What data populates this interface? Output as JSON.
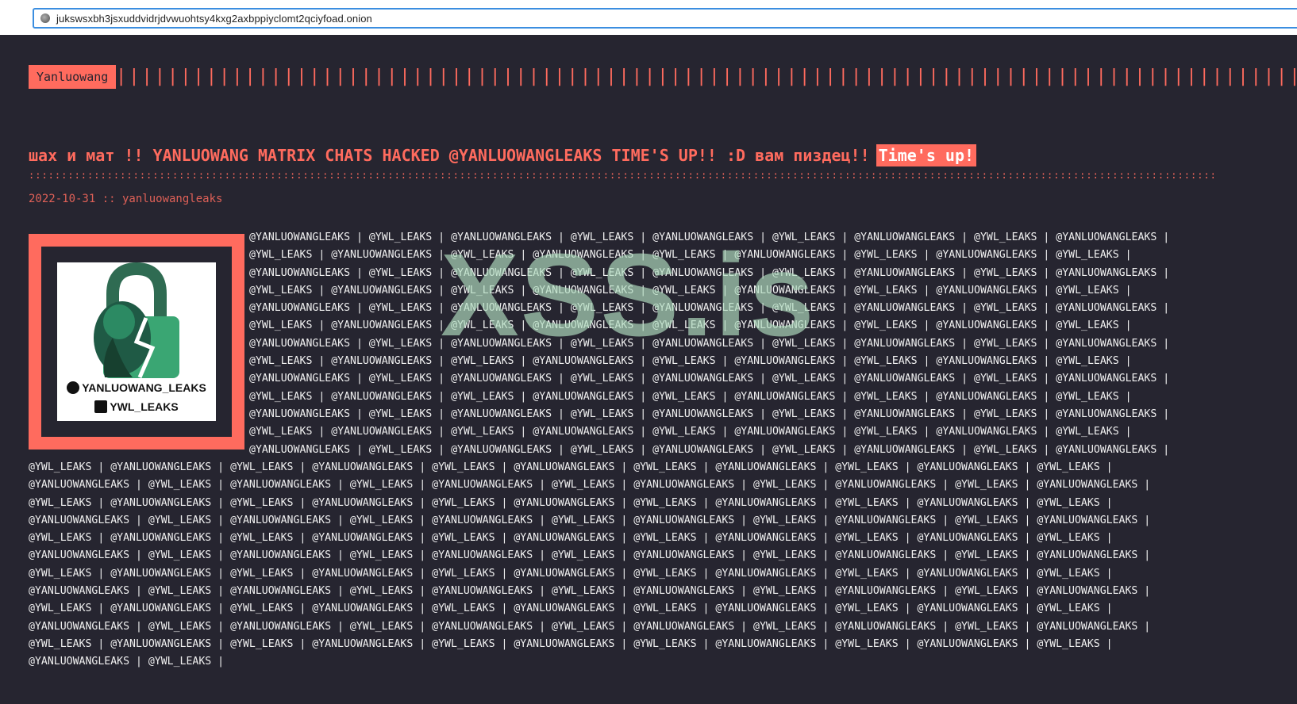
{
  "browser": {
    "url": "jukswsxbh3jsxuddvidrjdvwuohtsy4kxg2axbppiyclomt2qciyfoad.onion"
  },
  "site": {
    "logo": "Yanluowang"
  },
  "post": {
    "title": "шах и мат !! YANLUOWANG MATRIX CHATS HACKED @YANLUOWANGLEAKS TIME'S UP!! :D вам пиздец!!",
    "title_highlight": "Time's up!",
    "meta": "2022-10-31 :: yanluowangleaks"
  },
  "avatar": {
    "handle_twitter": "YANLUOWANG_LEAKS",
    "handle_telegram": "YWL_LEAKS",
    "twitter_icon": "twitter-icon",
    "telegram_icon": "telegram-icon"
  },
  "leak": {
    "top": "@YANLUOWANGLEAKS | @YWL_LEAKS | @YANLUOWANGLEAKS | @YWL_LEAKS | @YANLUOWANGLEAKS | @YWL_LEAKS | @YANLUOWANGLEAKS | @YWL_LEAKS | @YANLUOWANGLEAKS |\n@YWL_LEAKS | @YANLUOWANGLEAKS | @YWL_LEAKS | @YANLUOWANGLEAKS | @YWL_LEAKS | @YANLUOWANGLEAKS | @YWL_LEAKS | @YANLUOWANGLEAKS | @YWL_LEAKS |\n@YANLUOWANGLEAKS | @YWL_LEAKS | @YANLUOWANGLEAKS | @YWL_LEAKS | @YANLUOWANGLEAKS | @YWL_LEAKS | @YANLUOWANGLEAKS | @YWL_LEAKS | @YANLUOWANGLEAKS |\n@YWL_LEAKS | @YANLUOWANGLEAKS | @YWL_LEAKS | @YANLUOWANGLEAKS | @YWL_LEAKS | @YANLUOWANGLEAKS | @YWL_LEAKS | @YANLUOWANGLEAKS | @YWL_LEAKS |\n@YANLUOWANGLEAKS | @YWL_LEAKS | @YANLUOWANGLEAKS | @YWL_LEAKS | @YANLUOWANGLEAKS | @YWL_LEAKS | @YANLUOWANGLEAKS | @YWL_LEAKS | @YANLUOWANGLEAKS |\n@YWL_LEAKS | @YANLUOWANGLEAKS | @YWL_LEAKS | @YANLUOWANGLEAKS | @YWL_LEAKS | @YANLUOWANGLEAKS | @YWL_LEAKS | @YANLUOWANGLEAKS | @YWL_LEAKS |\n@YANLUOWANGLEAKS | @YWL_LEAKS | @YANLUOWANGLEAKS | @YWL_LEAKS | @YANLUOWANGLEAKS | @YWL_LEAKS | @YANLUOWANGLEAKS | @YWL_LEAKS | @YANLUOWANGLEAKS |\n@YWL_LEAKS | @YANLUOWANGLEAKS | @YWL_LEAKS | @YANLUOWANGLEAKS | @YWL_LEAKS | @YANLUOWANGLEAKS | @YWL_LEAKS | @YANLUOWANGLEAKS | @YWL_LEAKS |\n@YANLUOWANGLEAKS | @YWL_LEAKS | @YANLUOWANGLEAKS | @YWL_LEAKS | @YANLUOWANGLEAKS | @YWL_LEAKS | @YANLUOWANGLEAKS | @YWL_LEAKS | @YANLUOWANGLEAKS |\n@YWL_LEAKS | @YANLUOWANGLEAKS | @YWL_LEAKS | @YANLUOWANGLEAKS | @YWL_LEAKS | @YANLUOWANGLEAKS | @YWL_LEAKS | @YANLUOWANGLEAKS | @YWL_LEAKS |\n@YANLUOWANGLEAKS | @YWL_LEAKS | @YANLUOWANGLEAKS | @YWL_LEAKS | @YANLUOWANGLEAKS | @YWL_LEAKS | @YANLUOWANGLEAKS | @YWL_LEAKS | @YANLUOWANGLEAKS |\n@YWL_LEAKS | @YANLUOWANGLEAKS | @YWL_LEAKS | @YANLUOWANGLEAKS | @YWL_LEAKS | @YANLUOWANGLEAKS | @YWL_LEAKS | @YANLUOWANGLEAKS | @YWL_LEAKS |\n@YANLUOWANGLEAKS | @YWL_LEAKS | @YANLUOWANGLEAKS | @YWL_LEAKS | @YANLUOWANGLEAKS | @YWL_LEAKS | @YANLUOWANGLEAKS | @YWL_LEAKS | @YANLUOWANGLEAKS |",
    "bottom": "@YWL_LEAKS | @YANLUOWANGLEAKS | @YWL_LEAKS | @YANLUOWANGLEAKS | @YWL_LEAKS | @YANLUOWANGLEAKS | @YWL_LEAKS | @YANLUOWANGLEAKS | @YWL_LEAKS | @YANLUOWANGLEAKS | @YWL_LEAKS |\n@YANLUOWANGLEAKS | @YWL_LEAKS | @YANLUOWANGLEAKS | @YWL_LEAKS | @YANLUOWANGLEAKS | @YWL_LEAKS | @YANLUOWANGLEAKS | @YWL_LEAKS | @YANLUOWANGLEAKS | @YWL_LEAKS | @YANLUOWANGLEAKS |\n@YWL_LEAKS | @YANLUOWANGLEAKS | @YWL_LEAKS | @YANLUOWANGLEAKS | @YWL_LEAKS | @YANLUOWANGLEAKS | @YWL_LEAKS | @YANLUOWANGLEAKS | @YWL_LEAKS | @YANLUOWANGLEAKS | @YWL_LEAKS |\n@YANLUOWANGLEAKS | @YWL_LEAKS | @YANLUOWANGLEAKS | @YWL_LEAKS | @YANLUOWANGLEAKS | @YWL_LEAKS | @YANLUOWANGLEAKS | @YWL_LEAKS | @YANLUOWANGLEAKS | @YWL_LEAKS | @YANLUOWANGLEAKS |\n@YWL_LEAKS | @YANLUOWANGLEAKS | @YWL_LEAKS | @YANLUOWANGLEAKS | @YWL_LEAKS | @YANLUOWANGLEAKS | @YWL_LEAKS | @YANLUOWANGLEAKS | @YWL_LEAKS | @YANLUOWANGLEAKS | @YWL_LEAKS |\n@YANLUOWANGLEAKS | @YWL_LEAKS | @YANLUOWANGLEAKS | @YWL_LEAKS | @YANLUOWANGLEAKS | @YWL_LEAKS | @YANLUOWANGLEAKS | @YWL_LEAKS | @YANLUOWANGLEAKS | @YWL_LEAKS | @YANLUOWANGLEAKS |\n@YWL_LEAKS | @YANLUOWANGLEAKS | @YWL_LEAKS | @YANLUOWANGLEAKS | @YWL_LEAKS | @YANLUOWANGLEAKS | @YWL_LEAKS | @YANLUOWANGLEAKS | @YWL_LEAKS | @YANLUOWANGLEAKS | @YWL_LEAKS |\n@YANLUOWANGLEAKS | @YWL_LEAKS | @YANLUOWANGLEAKS | @YWL_LEAKS | @YANLUOWANGLEAKS | @YWL_LEAKS | @YANLUOWANGLEAKS | @YWL_LEAKS | @YANLUOWANGLEAKS | @YWL_LEAKS | @YANLUOWANGLEAKS |\n@YWL_LEAKS | @YANLUOWANGLEAKS | @YWL_LEAKS | @YANLUOWANGLEAKS | @YWL_LEAKS | @YANLUOWANGLEAKS | @YWL_LEAKS | @YANLUOWANGLEAKS | @YWL_LEAKS | @YANLUOWANGLEAKS | @YWL_LEAKS |\n@YANLUOWANGLEAKS | @YWL_LEAKS | @YANLUOWANGLEAKS | @YWL_LEAKS | @YANLUOWANGLEAKS | @YWL_LEAKS | @YANLUOWANGLEAKS | @YWL_LEAKS | @YANLUOWANGLEAKS | @YWL_LEAKS | @YANLUOWANGLEAKS |\n@YWL_LEAKS | @YANLUOWANGLEAKS | @YWL_LEAKS | @YANLUOWANGLEAKS | @YWL_LEAKS | @YANLUOWANGLEAKS | @YWL_LEAKS | @YANLUOWANGLEAKS | @YWL_LEAKS | @YANLUOWANGLEAKS | @YWL_LEAKS |\n@YANLUOWANGLEAKS | @YWL_LEAKS |"
  },
  "watermark": "XSS.is",
  "colors": {
    "accent": "#ff6b5e",
    "background": "#262530",
    "text": "#f1f1f1",
    "watermark": "#b0dcbe"
  }
}
